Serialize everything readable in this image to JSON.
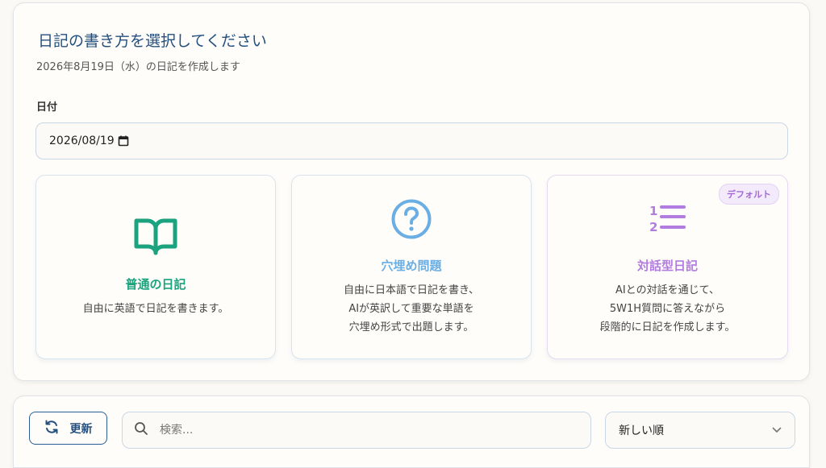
{
  "header": {
    "title": "日記の書き方を選択してください",
    "subtitle": "2026年8月19日（水）の日記を作成します"
  },
  "date_field": {
    "label": "日付",
    "value": "2026/08/19",
    "icon": "calendar-icon"
  },
  "cards": [
    {
      "title": "普通の日記",
      "icon": "open-book-icon",
      "color": "#1aa37e",
      "description": [
        "自由に英語で日記を書きます。"
      ]
    },
    {
      "title": "穴埋め問題",
      "icon": "question-circle-icon",
      "color": "#6aaee4",
      "description": [
        "自由に日本語で日記を書き、",
        "AIが英訳して重要な単語を",
        "穴埋め形式で出題します。"
      ]
    },
    {
      "title": "対話型日記",
      "icon": "numbered-list-icon",
      "color": "#b27be0",
      "badge": "デフォルト",
      "description": [
        "AIとの対話を通じて、",
        "5W1H質問に答えながら",
        "段階的に日記を作成します。"
      ]
    }
  ],
  "toolbar": {
    "refresh_label": "更新",
    "refresh_icon": "refresh-icon",
    "search_placeholder": "検索...",
    "search_icon": "search-icon",
    "sort_value": "新しい順",
    "sort_icon": "chevron-down-icon"
  },
  "colors": {
    "accent": "#24507f",
    "border": "#c9d6e6",
    "background": "#fbf9f5"
  }
}
